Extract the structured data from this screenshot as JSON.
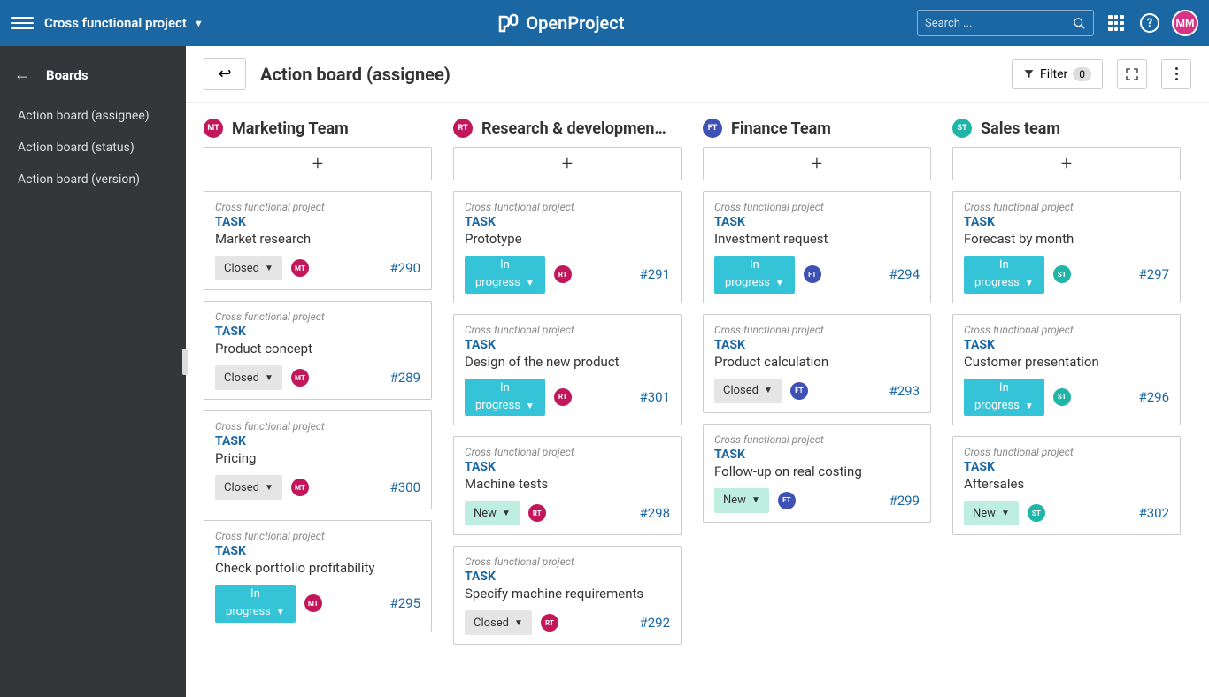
{
  "topbar": {
    "project_name": "Cross functional project",
    "logo_text": "OpenProject",
    "search_placeholder": "Search ...",
    "user_initials": "MM"
  },
  "sidebar": {
    "title": "Boards",
    "items": [
      {
        "label": "Action board (assignee)"
      },
      {
        "label": "Action board (status)"
      },
      {
        "label": "Action board (version)"
      }
    ]
  },
  "toolbar": {
    "board_title": "Action board (assignee)",
    "filter_label": "Filter",
    "filter_count": "0"
  },
  "colors": {
    "mt": "#c2185b",
    "rt": "#c2185b",
    "ft": "#3f51b5",
    "st": "#1fb5a7"
  },
  "columns": [
    {
      "title": "Marketing Team",
      "avatar": "MT",
      "avatar_color": "#c2185b",
      "cards": [
        {
          "project": "Cross functional project",
          "type": "TASK",
          "title": "Market research",
          "status": "Closed",
          "status_kind": "closed",
          "assignee": "MT",
          "assignee_color": "#c2185b",
          "id": "#290"
        },
        {
          "project": "Cross functional project",
          "type": "TASK",
          "title": "Product concept",
          "status": "Closed",
          "status_kind": "closed",
          "assignee": "MT",
          "assignee_color": "#c2185b",
          "id": "#289"
        },
        {
          "project": "Cross functional project",
          "type": "TASK",
          "title": "Pricing",
          "status": "Closed",
          "status_kind": "closed",
          "assignee": "MT",
          "assignee_color": "#c2185b",
          "id": "#300"
        },
        {
          "project": "Cross functional project",
          "type": "TASK",
          "title": "Check portfolio profitability",
          "status": "In progress",
          "status_kind": "inprogress",
          "assignee": "MT",
          "assignee_color": "#c2185b",
          "id": "#295"
        }
      ]
    },
    {
      "title": "Research & developmen…",
      "avatar": "RT",
      "avatar_color": "#c2185b",
      "cards": [
        {
          "project": "Cross functional project",
          "type": "TASK",
          "title": "Prototype",
          "status": "In progress",
          "status_kind": "inprogress",
          "assignee": "RT",
          "assignee_color": "#c2185b",
          "id": "#291"
        },
        {
          "project": "Cross functional project",
          "type": "TASK",
          "title": "Design of the new product",
          "status": "In progress",
          "status_kind": "inprogress",
          "assignee": "RT",
          "assignee_color": "#c2185b",
          "id": "#301"
        },
        {
          "project": "Cross functional project",
          "type": "TASK",
          "title": "Machine tests",
          "status": "New",
          "status_kind": "new",
          "assignee": "RT",
          "assignee_color": "#c2185b",
          "id": "#298"
        },
        {
          "project": "Cross functional project",
          "type": "TASK",
          "title": "Specify machine requirements",
          "status": "Closed",
          "status_kind": "closed",
          "assignee": "RT",
          "assignee_color": "#c2185b",
          "id": "#292"
        }
      ]
    },
    {
      "title": "Finance Team",
      "avatar": "FT",
      "avatar_color": "#3f51b5",
      "cards": [
        {
          "project": "Cross functional project",
          "type": "TASK",
          "title": "Investment request",
          "status": "In progress",
          "status_kind": "inprogress",
          "assignee": "FT",
          "assignee_color": "#3f51b5",
          "id": "#294"
        },
        {
          "project": "Cross functional project",
          "type": "TASK",
          "title": "Product calculation",
          "status": "Closed",
          "status_kind": "closed",
          "assignee": "FT",
          "assignee_color": "#3f51b5",
          "id": "#293"
        },
        {
          "project": "Cross functional project",
          "type": "TASK",
          "title": "Follow-up on real costing",
          "status": "New",
          "status_kind": "new",
          "assignee": "FT",
          "assignee_color": "#3f51b5",
          "id": "#299"
        }
      ]
    },
    {
      "title": "Sales team",
      "avatar": "ST",
      "avatar_color": "#1fb5a7",
      "cards": [
        {
          "project": "Cross functional project",
          "type": "TASK",
          "title": "Forecast by month",
          "status": "In progress",
          "status_kind": "inprogress",
          "assignee": "ST",
          "assignee_color": "#1fb5a7",
          "id": "#297"
        },
        {
          "project": "Cross functional project",
          "type": "TASK",
          "title": "Customer presentation",
          "status": "In progress",
          "status_kind": "inprogress",
          "assignee": "ST",
          "assignee_color": "#1fb5a7",
          "id": "#296"
        },
        {
          "project": "Cross functional project",
          "type": "TASK",
          "title": "Aftersales",
          "status": "New",
          "status_kind": "new",
          "assignee": "ST",
          "assignee_color": "#1fb5a7",
          "id": "#302"
        }
      ]
    }
  ]
}
